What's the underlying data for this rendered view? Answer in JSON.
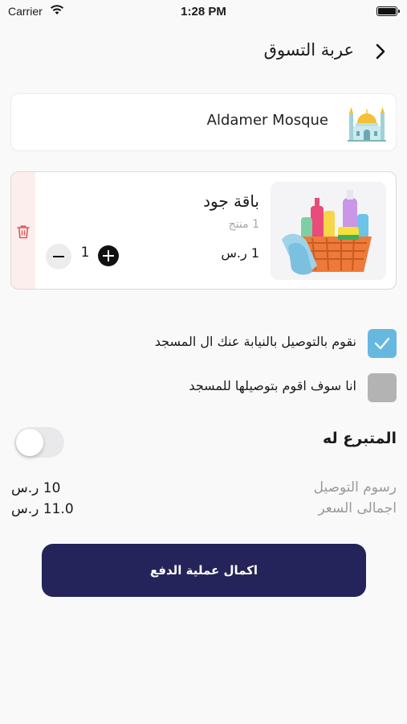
{
  "status_bar": {
    "carrier": "Carrier",
    "time": "1:28 PM",
    "wifi_icon": "wifi-icon",
    "battery_icon": "battery-icon"
  },
  "header": {
    "title": "عربة التسوق",
    "back_icon": "chevron-right-icon"
  },
  "mosque": {
    "name": "Aldamer Mosque",
    "icon": "mosque-icon"
  },
  "cart_item": {
    "name": "باقة جود",
    "count": "1 منتج",
    "price": "1 ر.س",
    "quantity": "1",
    "delete_icon": "trash-icon",
    "image": "cleaning-supplies-basket"
  },
  "delivery_options": [
    {
      "label": "نقوم بالتوصيل بالنيابة عنك ال المسجد",
      "checked": true
    },
    {
      "label": "انا سوف اقوم بتوصيلها للمسجد",
      "checked": false
    }
  ],
  "donor": {
    "label": "المتبرع له",
    "toggle_on": false
  },
  "summary": {
    "delivery_fee_label": "رسوم التوصيل",
    "delivery_fee_value": "10 ر.س",
    "total_label": "اجمالى السعر",
    "total_value": "11.0 ر.س"
  },
  "checkout": {
    "label": "اكمال عملية الدفع"
  },
  "colors": {
    "primary": "#24245a",
    "checkbox_checked": "#67b8e0",
    "checkbox_unchecked": "#b3b3b3",
    "delete_bg": "#fdeeee",
    "delete_icon": "#e05555"
  }
}
